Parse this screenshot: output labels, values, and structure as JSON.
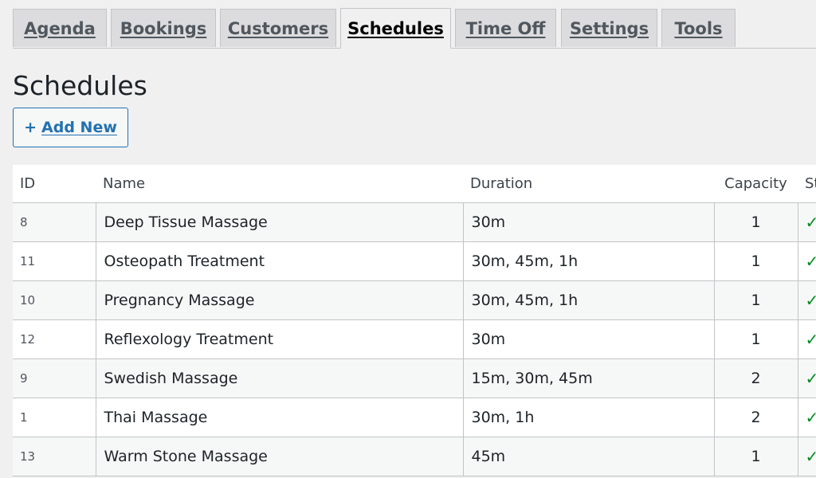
{
  "tabs": [
    {
      "label": "Agenda",
      "active": false
    },
    {
      "label": "Bookings",
      "active": false
    },
    {
      "label": "Customers",
      "active": false
    },
    {
      "label": "Schedules",
      "active": true
    },
    {
      "label": "Time Off",
      "active": false
    },
    {
      "label": "Settings",
      "active": false
    },
    {
      "label": "Tools",
      "active": false
    }
  ],
  "page": {
    "title": "Schedules",
    "add_new_plus": "+",
    "add_new_label": "Add New"
  },
  "table": {
    "columns": {
      "id": "ID",
      "name": "Name",
      "duration": "Duration",
      "capacity": "Capacity",
      "status": "St"
    },
    "rows": [
      {
        "id": "8",
        "name": "Deep Tissue Massage",
        "duration": "30m",
        "capacity": "1",
        "status": "✓"
      },
      {
        "id": "11",
        "name": "Osteopath Treatment",
        "duration": "30m, 45m, 1h",
        "capacity": "1",
        "status": "✓"
      },
      {
        "id": "10",
        "name": "Pregnancy Massage",
        "duration": "30m, 45m, 1h",
        "capacity": "1",
        "status": "✓"
      },
      {
        "id": "12",
        "name": "Reflexology Treatment",
        "duration": "30m",
        "capacity": "1",
        "status": "✓"
      },
      {
        "id": "9",
        "name": "Swedish Massage",
        "duration": "15m, 30m, 45m",
        "capacity": "2",
        "status": "✓"
      },
      {
        "id": "1",
        "name": "Thai Massage",
        "duration": "30m, 1h",
        "capacity": "2",
        "status": "✓"
      },
      {
        "id": "13",
        "name": "Warm Stone Massage",
        "duration": "45m",
        "capacity": "1",
        "status": "✓"
      }
    ]
  },
  "colors": {
    "accent": "#2271b1",
    "status_ok": "#008a20",
    "background": "#f0f0f1"
  }
}
